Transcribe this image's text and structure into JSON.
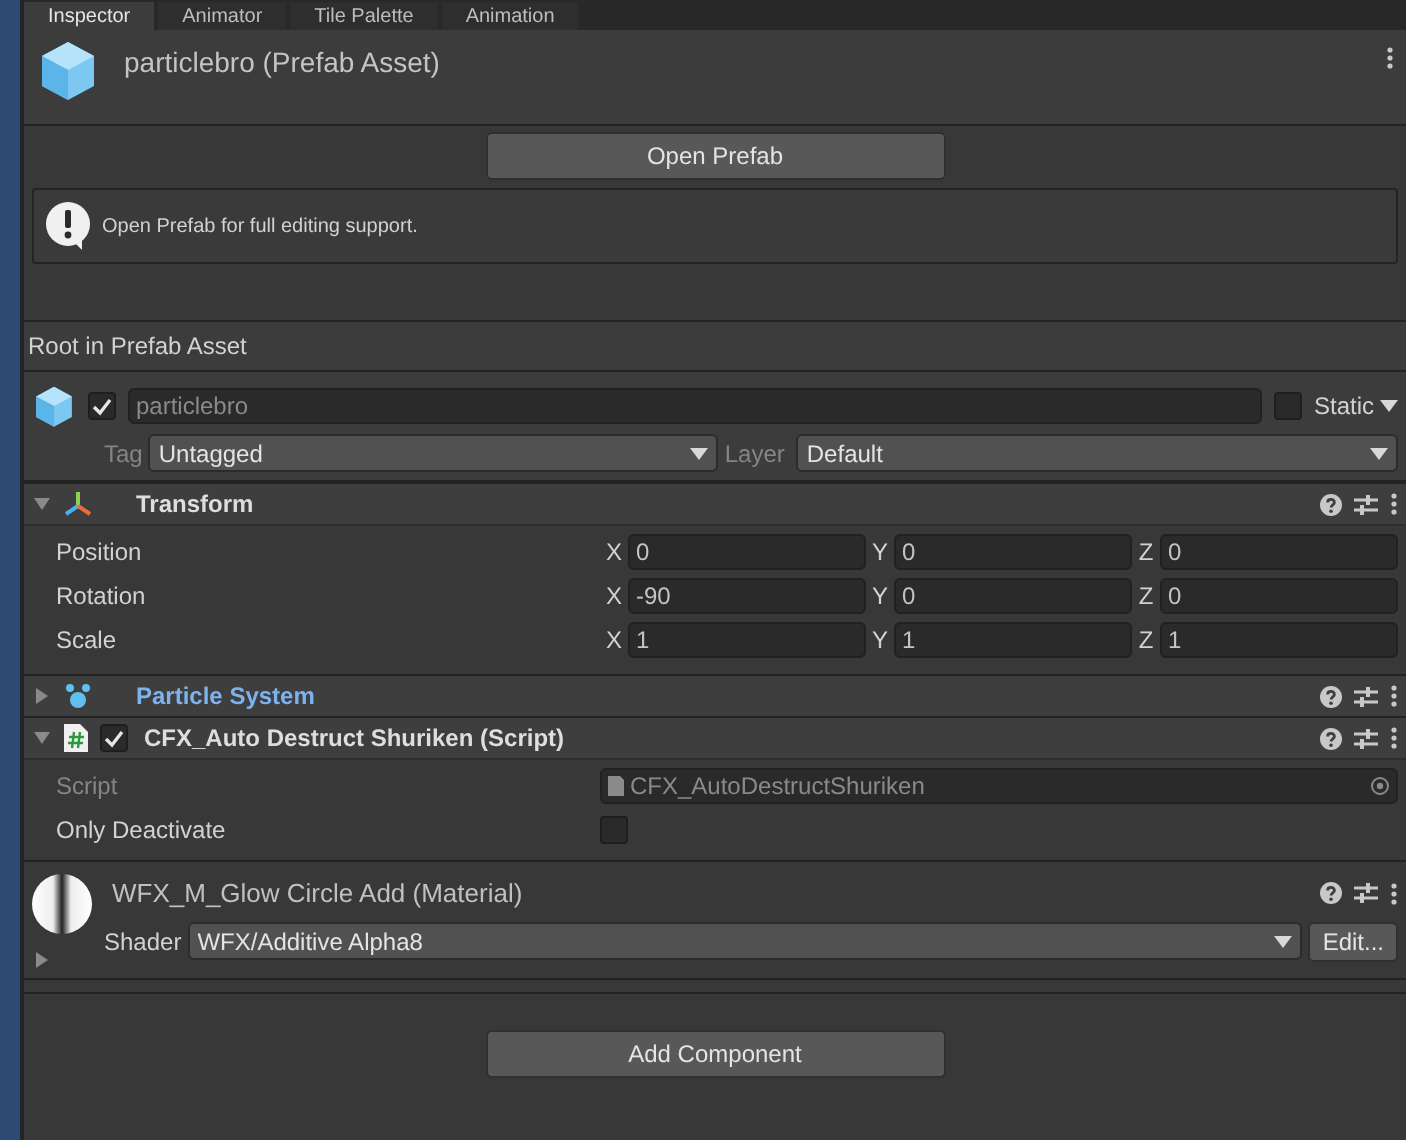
{
  "tabs": [
    {
      "label": "Inspector",
      "selected": true
    },
    {
      "label": "Animator",
      "selected": false
    },
    {
      "label": "Tile Palette",
      "selected": false
    },
    {
      "label": "Animation",
      "selected": false
    }
  ],
  "header": {
    "title": "particlebro (Prefab Asset)"
  },
  "open_button": "Open Prefab",
  "info": "Open Prefab for full editing support.",
  "root_label": "Root in Prefab Asset",
  "game_object": {
    "active": true,
    "name": "particlebro",
    "static": false,
    "static_label": "Static",
    "tag_label": "Tag",
    "tag": "Untagged",
    "layer_label": "Layer",
    "layer": "Default"
  },
  "components": [
    {
      "kind": "transform",
      "title": "Transform",
      "expanded": true,
      "overridden": false,
      "rows": [
        {
          "label": "Position",
          "fields": [
            {
              "axis": "X",
              "value": "0"
            },
            {
              "axis": "Y",
              "value": "0"
            },
            {
              "axis": "Z",
              "value": "0"
            }
          ]
        },
        {
          "label": "Rotation",
          "fields": [
            {
              "axis": "X",
              "value": "-90"
            },
            {
              "axis": "Y",
              "value": "0"
            },
            {
              "axis": "Z",
              "value": "0"
            }
          ]
        },
        {
          "label": "Scale",
          "fields": [
            {
              "axis": "X",
              "value": "1"
            },
            {
              "axis": "Y",
              "value": "1"
            },
            {
              "axis": "Z",
              "value": "1"
            }
          ]
        }
      ]
    },
    {
      "kind": "particles",
      "title": "Particle System",
      "expanded": false,
      "overridden": true
    },
    {
      "kind": "script",
      "title": "CFX_Auto Destruct Shuriken (Script)",
      "expanded": true,
      "overridden": false,
      "enabled": true,
      "script_label": "Script",
      "script_value": "CFX_AutoDestructShuriken",
      "toggles": [
        {
          "label": "Only Deactivate",
          "checked": false
        }
      ]
    }
  ],
  "material": {
    "title": "WFX_M_Glow Circle Add (Material)",
    "expanded": false,
    "shader_label": "Shader",
    "shader": "WFX/Additive Alpha8",
    "edit_button": "Edit..."
  },
  "add_button": "Add Component"
}
